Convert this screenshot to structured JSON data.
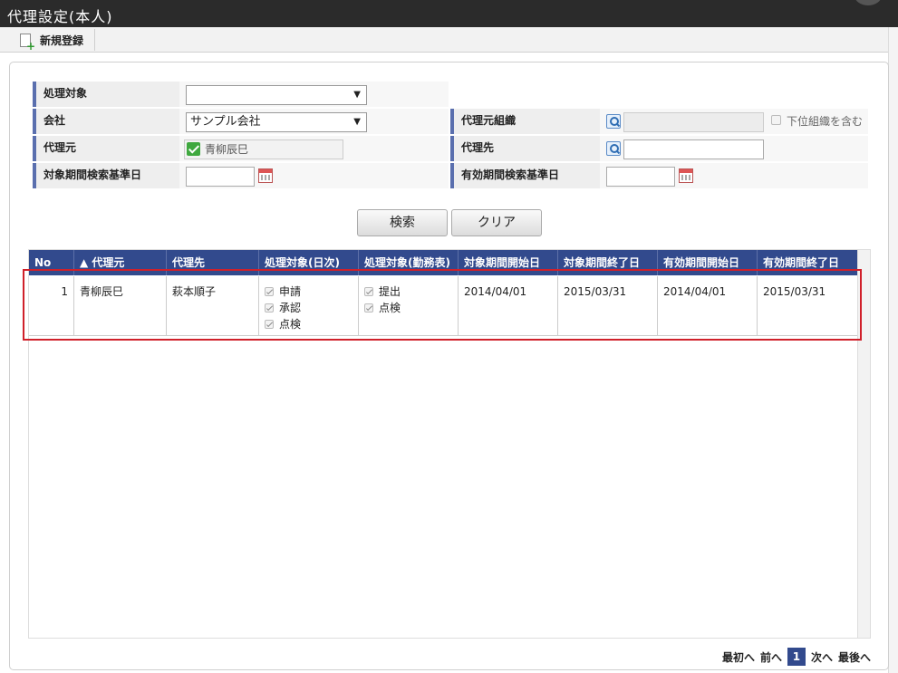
{
  "window": {
    "title": "代理設定(本人)"
  },
  "toolbar": {
    "new_label": "新規登録"
  },
  "form": {
    "target_label": "処理対象",
    "target_value": "",
    "company_label": "会社",
    "company_value": "サンプル会社",
    "proxy_org_label": "代理元組織",
    "include_sub_label": "下位組織を含む",
    "proxy_source_label": "代理元",
    "proxy_source_value": "青柳辰巳",
    "proxy_dest_label": "代理先",
    "target_period_label": "対象期間検索基準日",
    "valid_period_label": "有効期間検索基準日"
  },
  "buttons": {
    "search": "検索",
    "clear": "クリア"
  },
  "table": {
    "headers": [
      "No",
      "▲ 代理元",
      "代理先",
      "処理対象(日次)",
      "処理対象(勤務表)",
      "対象期間開始日",
      "対象期間終了日",
      "有効期間開始日",
      "有効期間終了日"
    ],
    "rows": [
      {
        "no": "1",
        "source": "青柳辰巳",
        "dest": "萩本順子",
        "daily": [
          "申請",
          "承認",
          "点検"
        ],
        "timesheet": [
          "提出",
          "点検"
        ],
        "target_start": "2014/04/01",
        "target_end": "2015/03/31",
        "valid_start": "2014/04/01",
        "valid_end": "2015/03/31"
      }
    ]
  },
  "pager": {
    "first": "最初へ",
    "prev": "前へ",
    "current": "1",
    "next": "次へ",
    "last": "最後へ"
  }
}
